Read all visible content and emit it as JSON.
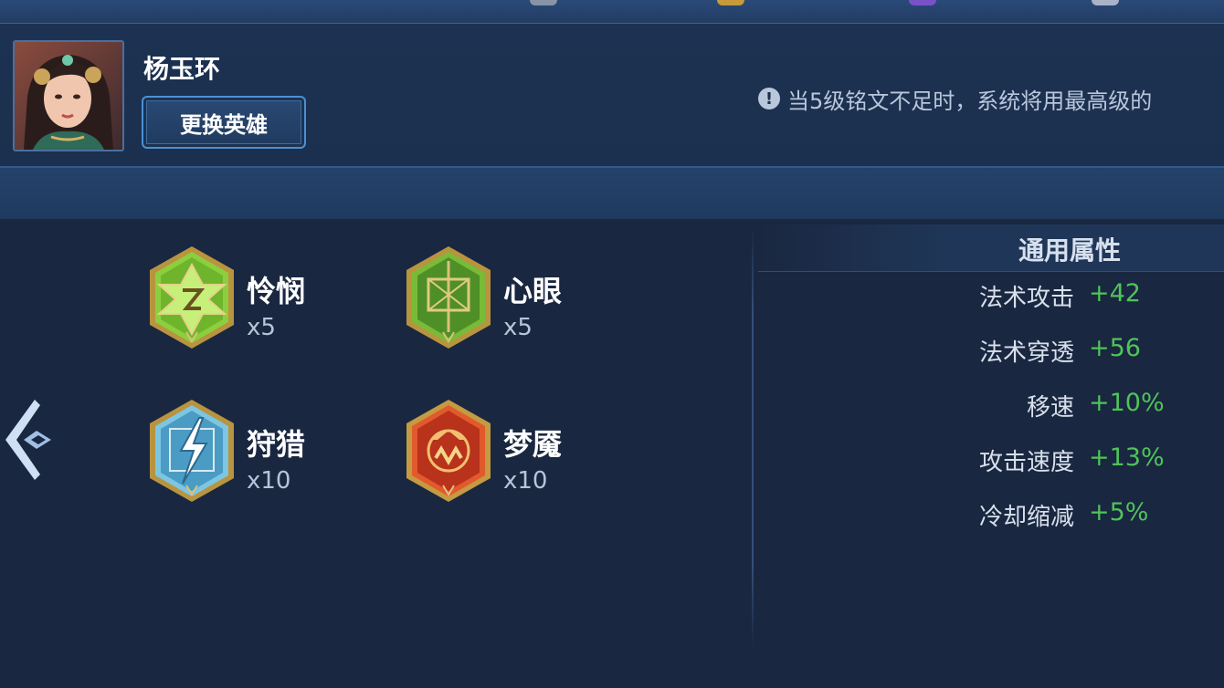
{
  "hero": {
    "name": "杨玉环",
    "change_button": "更换英雄"
  },
  "notice": {
    "icon": "exclamation-icon",
    "text": "当5级铭文不足时，系统将用最高级的"
  },
  "runes": [
    {
      "name": "怜悯",
      "count": "x5",
      "icon": "pity-rune-icon",
      "color": "#7fc23a"
    },
    {
      "name": "心眼",
      "count": "x5",
      "icon": "insight-rune-icon",
      "color": "#5aa638"
    },
    {
      "name": "狩猎",
      "count": "x10",
      "icon": "hunt-rune-icon",
      "color": "#5ab3d8"
    },
    {
      "name": "梦魇",
      "count": "x10",
      "icon": "nightmare-rune-icon",
      "color": "#d9442a"
    }
  ],
  "stats": {
    "title": "通用属性",
    "rows": [
      {
        "label": "法术攻击",
        "value": "+42"
      },
      {
        "label": "法术穿透",
        "value": "+56"
      },
      {
        "label": "移速",
        "value": "+10%"
      },
      {
        "label": "攻击速度",
        "value": "+13%"
      },
      {
        "label": "冷却缩减",
        "value": "+5%"
      }
    ]
  },
  "colors": {
    "accent_green": "#4fc35a",
    "background": "#1a2740",
    "panel": "#1d3252"
  }
}
